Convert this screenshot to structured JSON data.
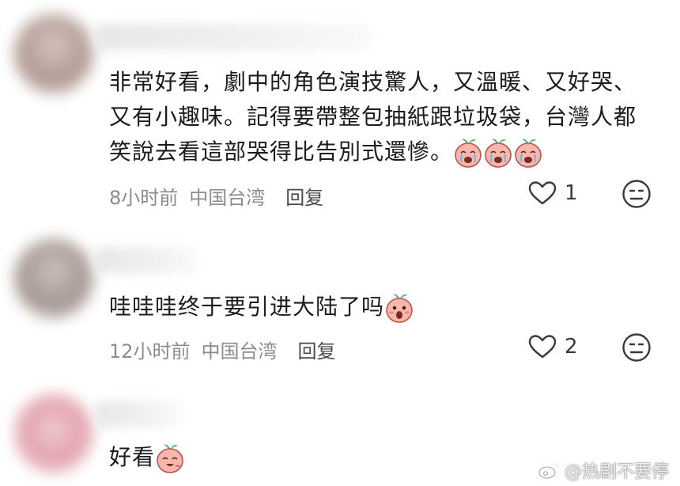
{
  "comments": [
    {
      "text_lines": [
        "非常好看，劇中的角色演技驚人，又溫暖、又好哭、",
        "又有小趣味。記得要帶整包抽紙跟垃圾袋，台灣人都",
        "笑說去看這部哭得比告別式還慘。"
      ],
      "time": "8小时前",
      "location": "中国台湾",
      "reply": "回复",
      "likes": "1"
    },
    {
      "text": "哇哇哇终于要引进大陆了吗",
      "time": "12小时前",
      "location": "中国台湾",
      "reply": "回复",
      "likes": "2"
    },
    {
      "text": "好看"
    }
  ],
  "watermark": "@热剧不要停",
  "icons": {
    "like": "heart-outline-icon",
    "dislike": "neutral-face-icon",
    "emoji": "peach-emoji-icon",
    "watermark": "weibo-logo-icon"
  },
  "colors": {
    "text": "#1b1b1b",
    "meta": "#8c8c8c",
    "emoji_pink": "#f7b1a8"
  }
}
